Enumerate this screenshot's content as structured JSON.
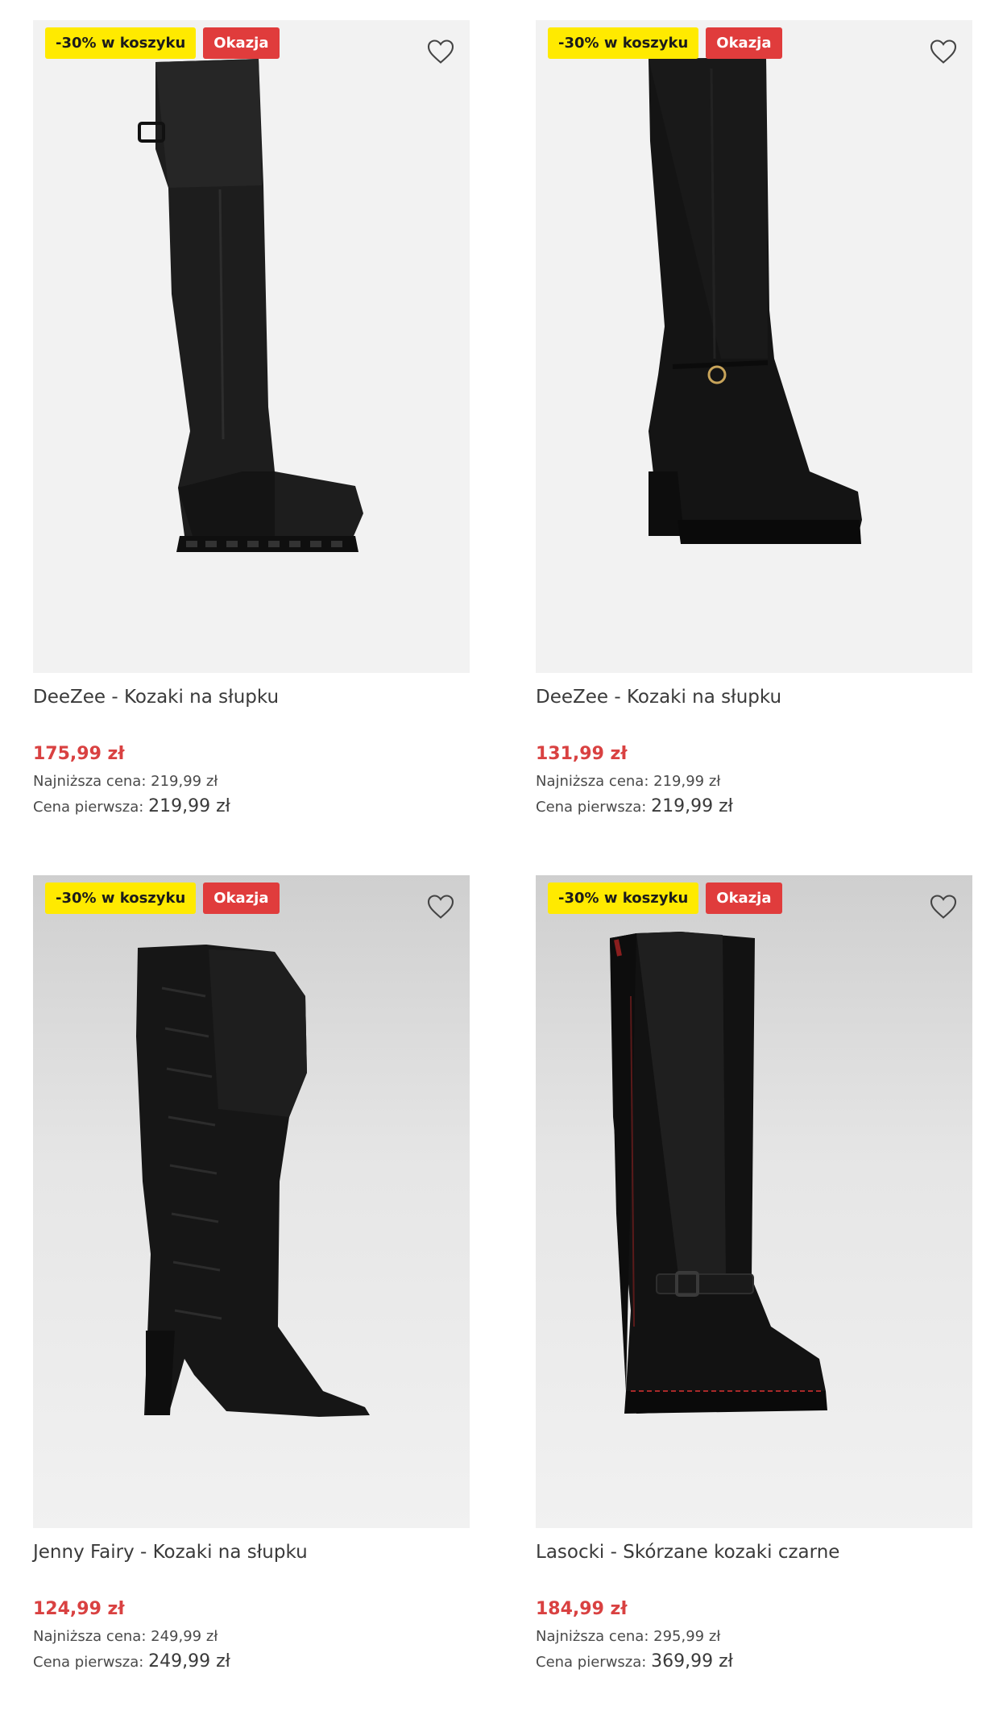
{
  "colors": {
    "promo_badge_bg": "#ffea00",
    "deal_badge_bg": "#e03c3c",
    "price_color": "#d94141"
  },
  "products": [
    {
      "promo_badge": "-30% w koszyku",
      "deal_badge": "Okazja",
      "favorite_icon": "heart-outline-icon",
      "title": "DeeZee - Kozaki na słupku",
      "price": "175,99 zł",
      "lowest_label": "Najniższa cena:",
      "lowest_value": "219,99 zł",
      "first_label": "Cena pierwsza:",
      "first_value": "219,99 zł"
    },
    {
      "promo_badge": "-30% w koszyku",
      "deal_badge": "Okazja",
      "favorite_icon": "heart-outline-icon",
      "title": "DeeZee - Kozaki na słupku",
      "price": "131,99 zł",
      "lowest_label": "Najniższa cena:",
      "lowest_value": "219,99 zł",
      "first_label": "Cena pierwsza:",
      "first_value": "219,99 zł"
    },
    {
      "promo_badge": "-30% w koszyku",
      "deal_badge": "Okazja",
      "favorite_icon": "heart-outline-icon",
      "title": "Jenny Fairy - Kozaki na słupku",
      "price": "124,99 zł",
      "lowest_label": "Najniższa cena:",
      "lowest_value": "249,99 zł",
      "first_label": "Cena pierwsza:",
      "first_value": "249,99 zł"
    },
    {
      "promo_badge": "-30% w koszyku",
      "deal_badge": "Okazja",
      "favorite_icon": "heart-outline-icon",
      "title": "Lasocki - Skórzane kozaki czarne",
      "price": "184,99 zł",
      "lowest_label": "Najniższa cena:",
      "lowest_value": "295,99 zł",
      "first_label": "Cena pierwsza:",
      "first_value": "369,99 zł"
    }
  ]
}
